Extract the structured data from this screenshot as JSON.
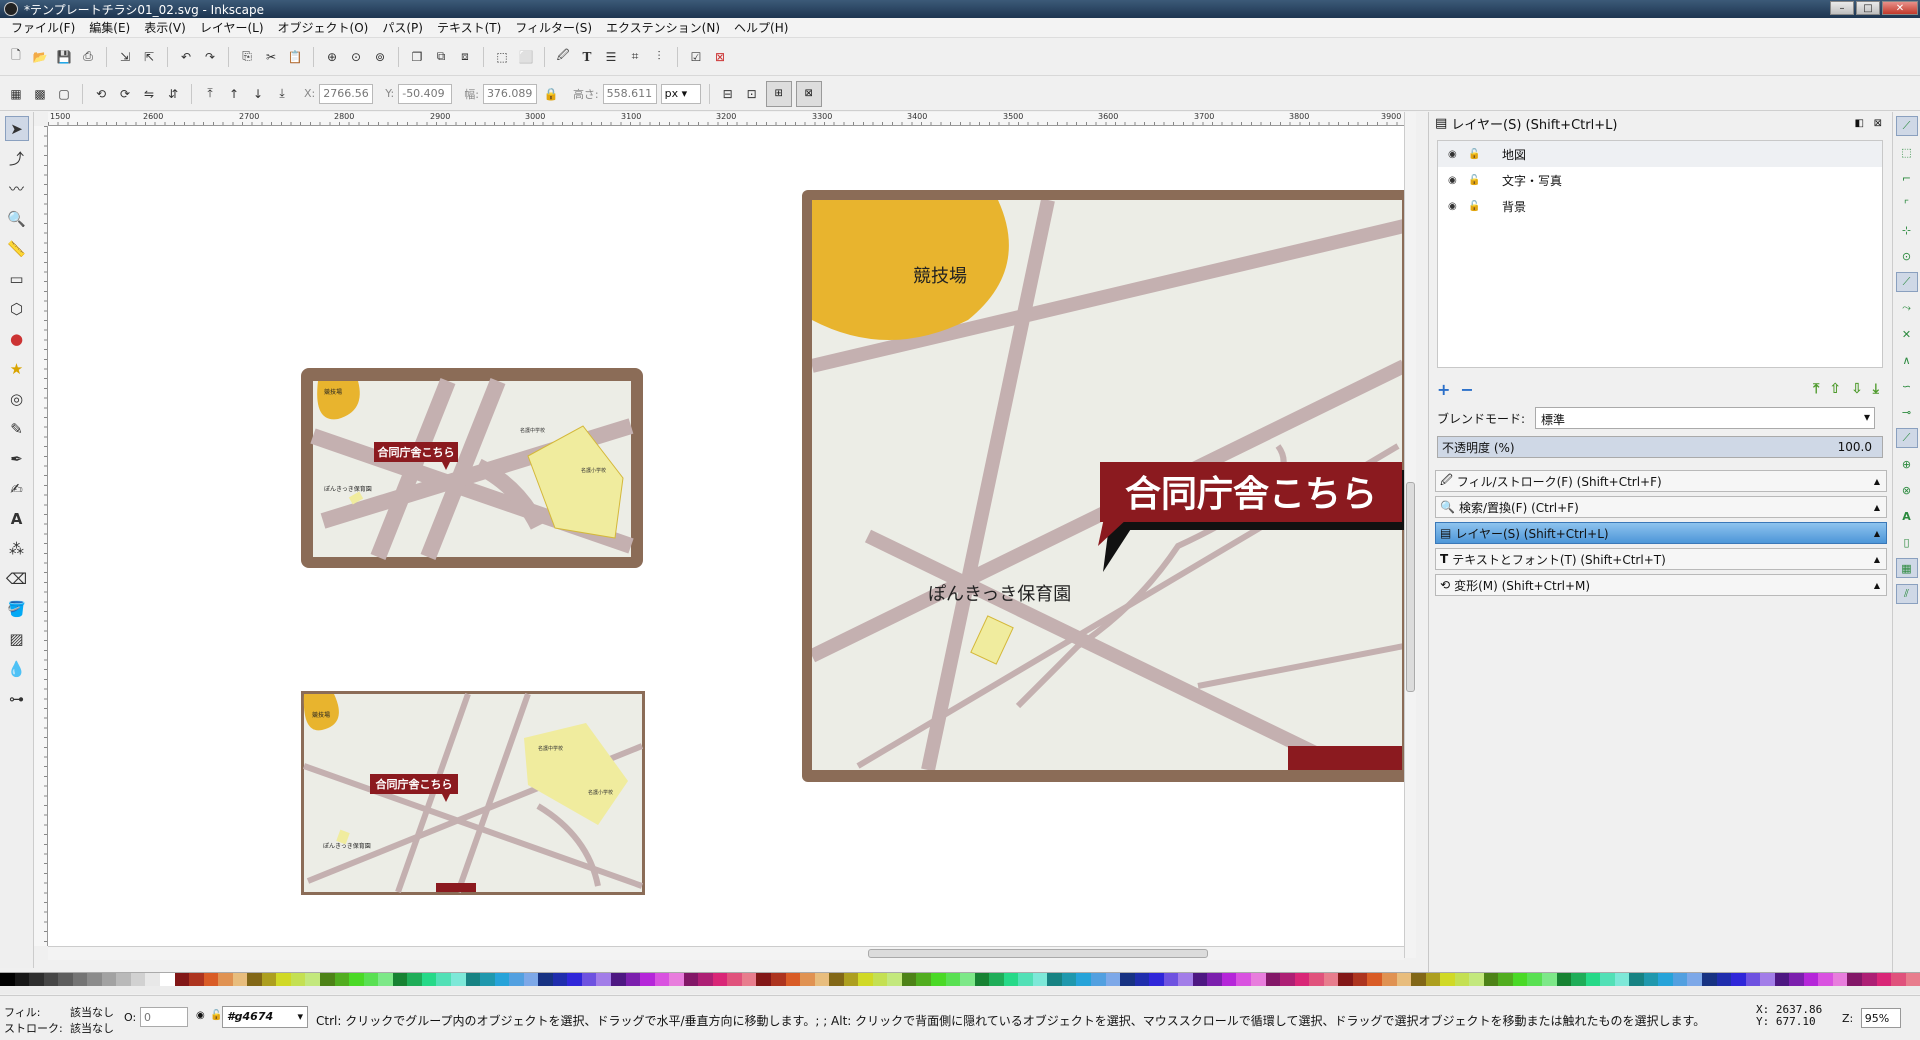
{
  "window": {
    "title": "*テンプレートチラシ01_02.svg - Inkscape"
  },
  "menu": [
    "ファイル(F)",
    "編集(E)",
    "表示(V)",
    "レイヤー(L)",
    "オブジェクト(O)",
    "パス(P)",
    "テキスト(T)",
    "フィルター(S)",
    "エクステンション(N)",
    "ヘルプ(H)"
  ],
  "controls": {
    "x_label": "X:",
    "x_value": "2766.56",
    "y_label": "Y:",
    "y_value": "-50.409",
    "w_label": "幅:",
    "w_value": "376.089",
    "h_label": "高さ:",
    "h_value": "558.611",
    "unit": "px"
  },
  "ruler": {
    "h_ticks": [
      "1500",
      "2600",
      "2700",
      "2800",
      "2900",
      "3000",
      "3100",
      "3200",
      "3300",
      "3400",
      "3500",
      "3600",
      "3700",
      "3800",
      "3900"
    ]
  },
  "map": {
    "stadium": "競技場",
    "callout": "合同庁舎こちら",
    "nursery": "ぽんきっき保育園",
    "school_middle": "名護中学校",
    "school_elementary": "名護小学校"
  },
  "layers_panel": {
    "title": "レイヤー(S) (Shift+Ctrl+L)",
    "layers": [
      "地図",
      "文字・写真",
      "背景"
    ],
    "blend_label": "ブレンドモード:",
    "blend_value": "標準",
    "opacity_label": "不透明度 (%)",
    "opacity_value": "100.0"
  },
  "dialogs": [
    "フィル/ストローク(F) (Shift+Ctrl+F)",
    "検索/置換(F) (Ctrl+F)",
    "レイヤー(S) (Shift+Ctrl+L)",
    "テキストとフォント(T) (Shift+Ctrl+T)",
    "変形(M) (Shift+Ctrl+M)"
  ],
  "status": {
    "fill_label": "フィル:",
    "fill_value": "該当なし",
    "stroke_label": "ストローク:",
    "stroke_value": "該当なし",
    "opacity_label": "O:",
    "opacity_value": "0",
    "layer": "#g4674",
    "message": "Ctrl: クリックでグループ内のオブジェクトを選択、ドラッグで水平/垂直方向に移動します。; ; Alt: クリックで背面側に隠れているオブジェクトを選択、マウススクロールで循環して選択、ドラッグで選択オブジェクトを移動または触れたものを選択します。",
    "x": "X: 2637.86",
    "y": "Y: 677.10",
    "zoom_label": "Z:",
    "zoom": "95%"
  },
  "colors": {
    "frame": "#8b6c57",
    "road": "#c4b0b0",
    "map_bg": "#ecede6",
    "stadium": "#e8b42e",
    "school": "#f0ec9e",
    "callout": "#8b1a1f"
  }
}
